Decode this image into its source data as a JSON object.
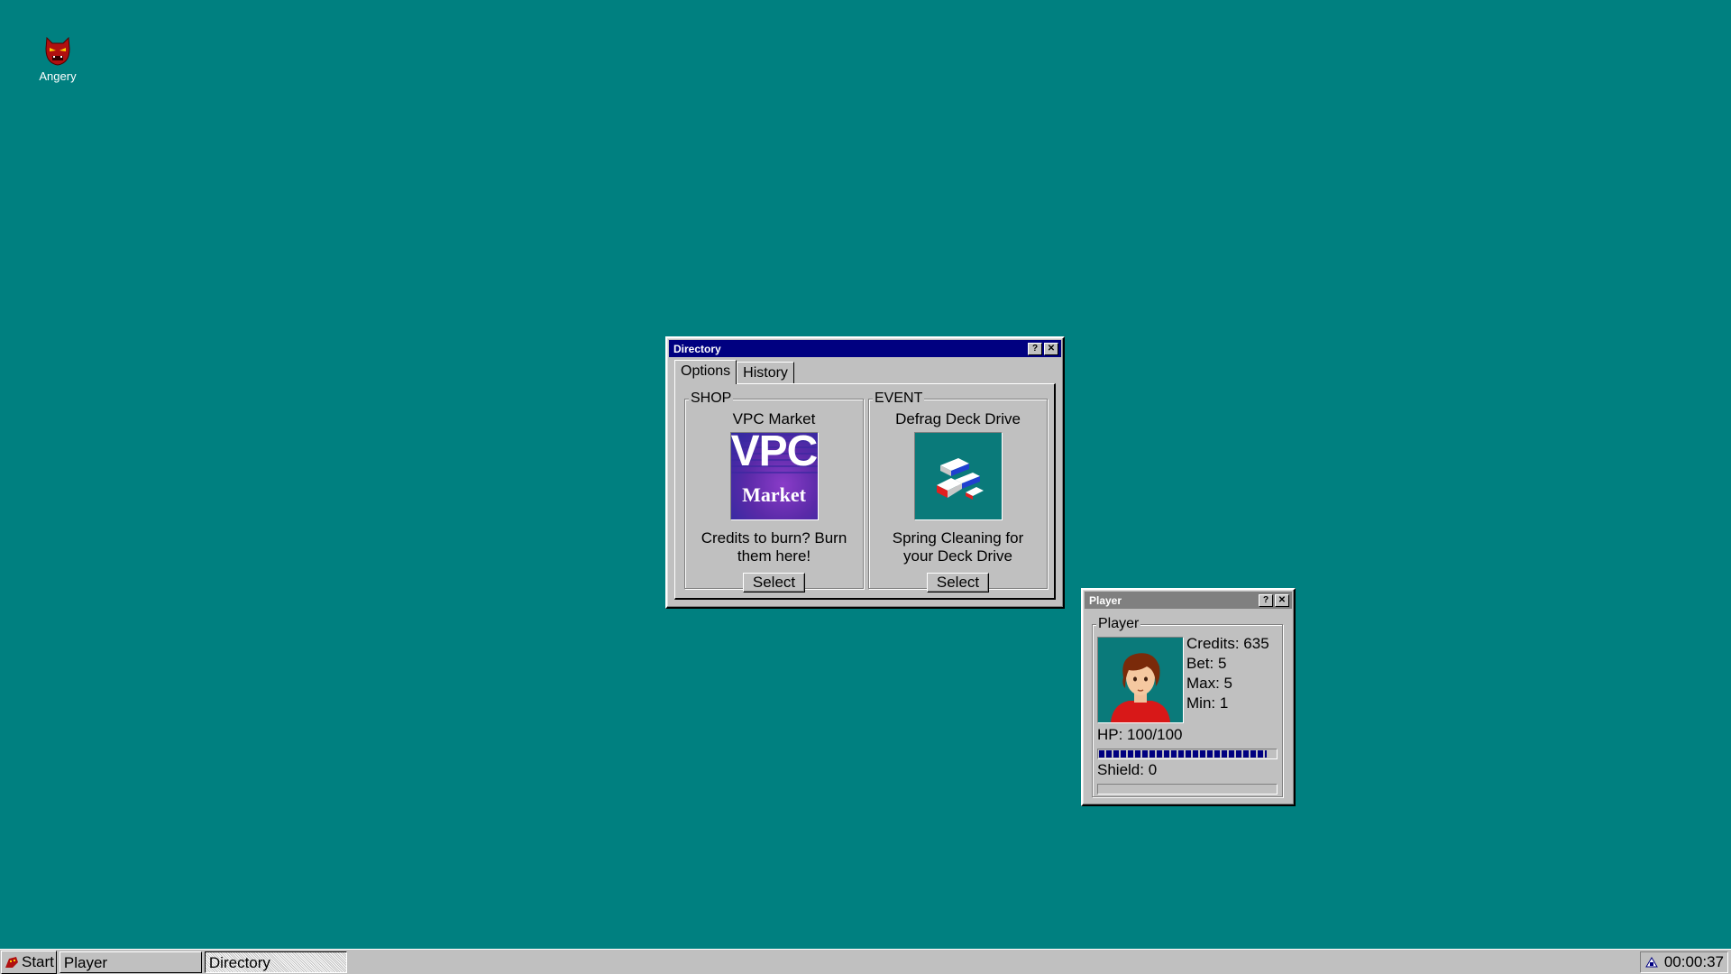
{
  "desktop": {
    "icons": [
      {
        "label": "Angery",
        "icon": "angry-face-icon"
      }
    ]
  },
  "directory_window": {
    "title": "Directory",
    "tabs": [
      {
        "label": "Options",
        "active": true
      },
      {
        "label": "History",
        "active": false
      }
    ],
    "shop": {
      "group_label": "SHOP",
      "title": "VPC Market",
      "logo_top": "VPC",
      "logo_bottom": "Market",
      "description": "Credits to burn? Burn them here!",
      "button": "Select"
    },
    "event": {
      "group_label": "EVENT",
      "title": "Defrag Deck Drive",
      "description": "Spring Cleaning for your Deck Drive",
      "button": "Select"
    }
  },
  "player_window": {
    "title": "Player",
    "group_label": "Player",
    "credits": "Credits: 635",
    "bet": "Bet: 5",
    "max": "Max: 5",
    "min": "Min: 1",
    "hp_text": "HP: 100/100",
    "hp_fraction": 0.95,
    "shield_text": "Shield: 0",
    "shield_fraction": 0
  },
  "taskbar": {
    "start_label": "Start",
    "tasks": [
      {
        "label": "Player",
        "pressed": false
      },
      {
        "label": "Directory",
        "pressed": true
      }
    ],
    "clock": "00:00:37"
  },
  "colors": {
    "desktop": "#008080",
    "title_active": "#000080",
    "title_inactive": "#808080",
    "face": "#c0c0c0"
  }
}
